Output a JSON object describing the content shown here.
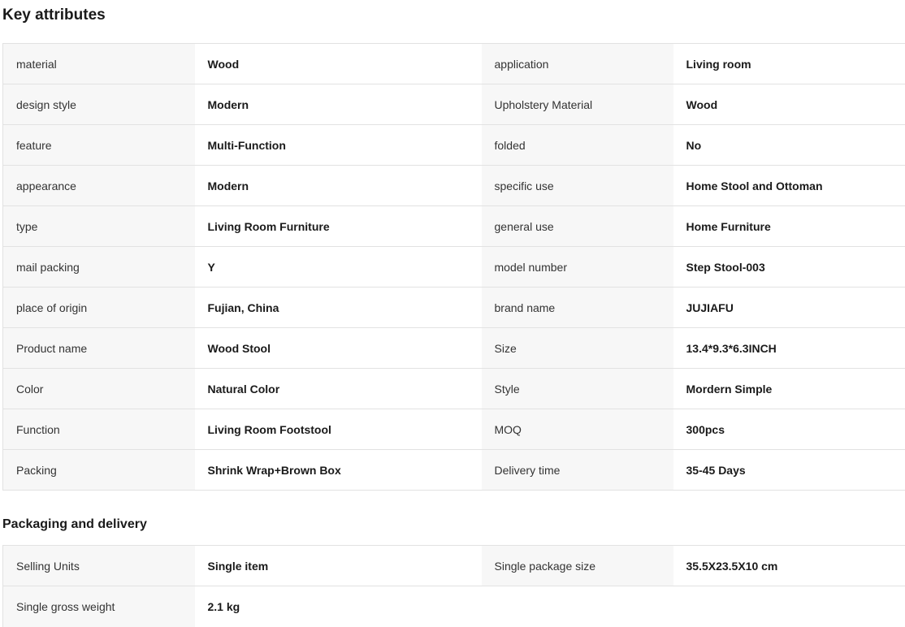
{
  "key_attributes": {
    "title": "Key attributes",
    "rows": [
      {
        "label1": "material",
        "value1": "Wood",
        "label2": "application",
        "value2": "Living room"
      },
      {
        "label1": "design style",
        "value1": "Modern",
        "label2": "Upholstery Material",
        "value2": "Wood"
      },
      {
        "label1": "feature",
        "value1": "Multi-Function",
        "label2": "folded",
        "value2": "No"
      },
      {
        "label1": "appearance",
        "value1": "Modern",
        "label2": "specific use",
        "value2": "Home Stool and Ottoman"
      },
      {
        "label1": "type",
        "value1": "Living Room Furniture",
        "label2": "general use",
        "value2": "Home Furniture"
      },
      {
        "label1": "mail packing",
        "value1": "Y",
        "label2": "model number",
        "value2": "Step Stool-003"
      },
      {
        "label1": "place of origin",
        "value1": "Fujian, China",
        "label2": "brand name",
        "value2": "JUJIAFU"
      },
      {
        "label1": "Product name",
        "value1": "Wood Stool",
        "label2": "Size",
        "value2": "13.4*9.3*6.3INCH"
      },
      {
        "label1": "Color",
        "value1": "Natural Color",
        "label2": "Style",
        "value2": "Mordern Simple"
      },
      {
        "label1": "Function",
        "value1": "Living Room Footstool",
        "label2": "MOQ",
        "value2": "300pcs"
      },
      {
        "label1": "Packing",
        "value1": "Shrink Wrap+Brown Box",
        "label2": "Delivery time",
        "value2": "35-45 Days"
      }
    ]
  },
  "packaging": {
    "title": "Packaging and delivery",
    "rows": [
      {
        "label1": "Selling Units",
        "value1": "Single item",
        "label2": "Single package size",
        "value2": "35.5X23.5X10 cm"
      },
      {
        "label1": "Single gross weight",
        "value1": "2.1 kg"
      }
    ]
  }
}
